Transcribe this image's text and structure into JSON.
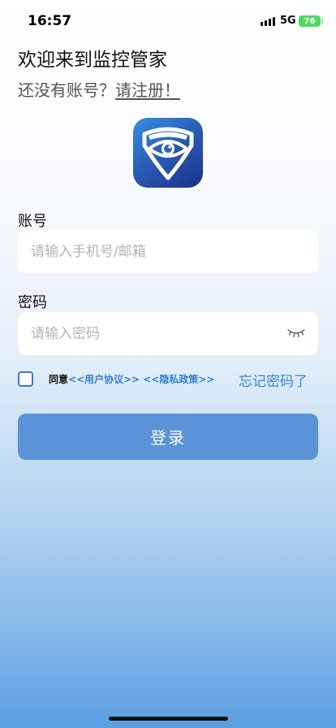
{
  "status_bar": {
    "time": "16:57",
    "network": "5G",
    "battery": "76"
  },
  "header": {
    "welcome_title": "欢迎来到监控管家",
    "register_prompt": "还没有账号？",
    "register_link": "请注册！"
  },
  "form": {
    "account_label": "账号",
    "account_placeholder": "请输入手机号/邮箱",
    "password_label": "密码",
    "password_placeholder": "请输入密码"
  },
  "agreement": {
    "agree_text": "同意",
    "user_agreement": "<<用户协议>>",
    "privacy_policy": "<<隐私政策>>"
  },
  "forgot_password": "忘记密码了",
  "login_button": "登录",
  "icons": {
    "logo": "eye-shield-icon",
    "password_toggle": "eye-closed-icon",
    "checkbox": "checkbox-icon"
  },
  "colors": {
    "accent": "#3a86d8",
    "login_button": "#5b93d8",
    "battery": "#4cd964"
  }
}
